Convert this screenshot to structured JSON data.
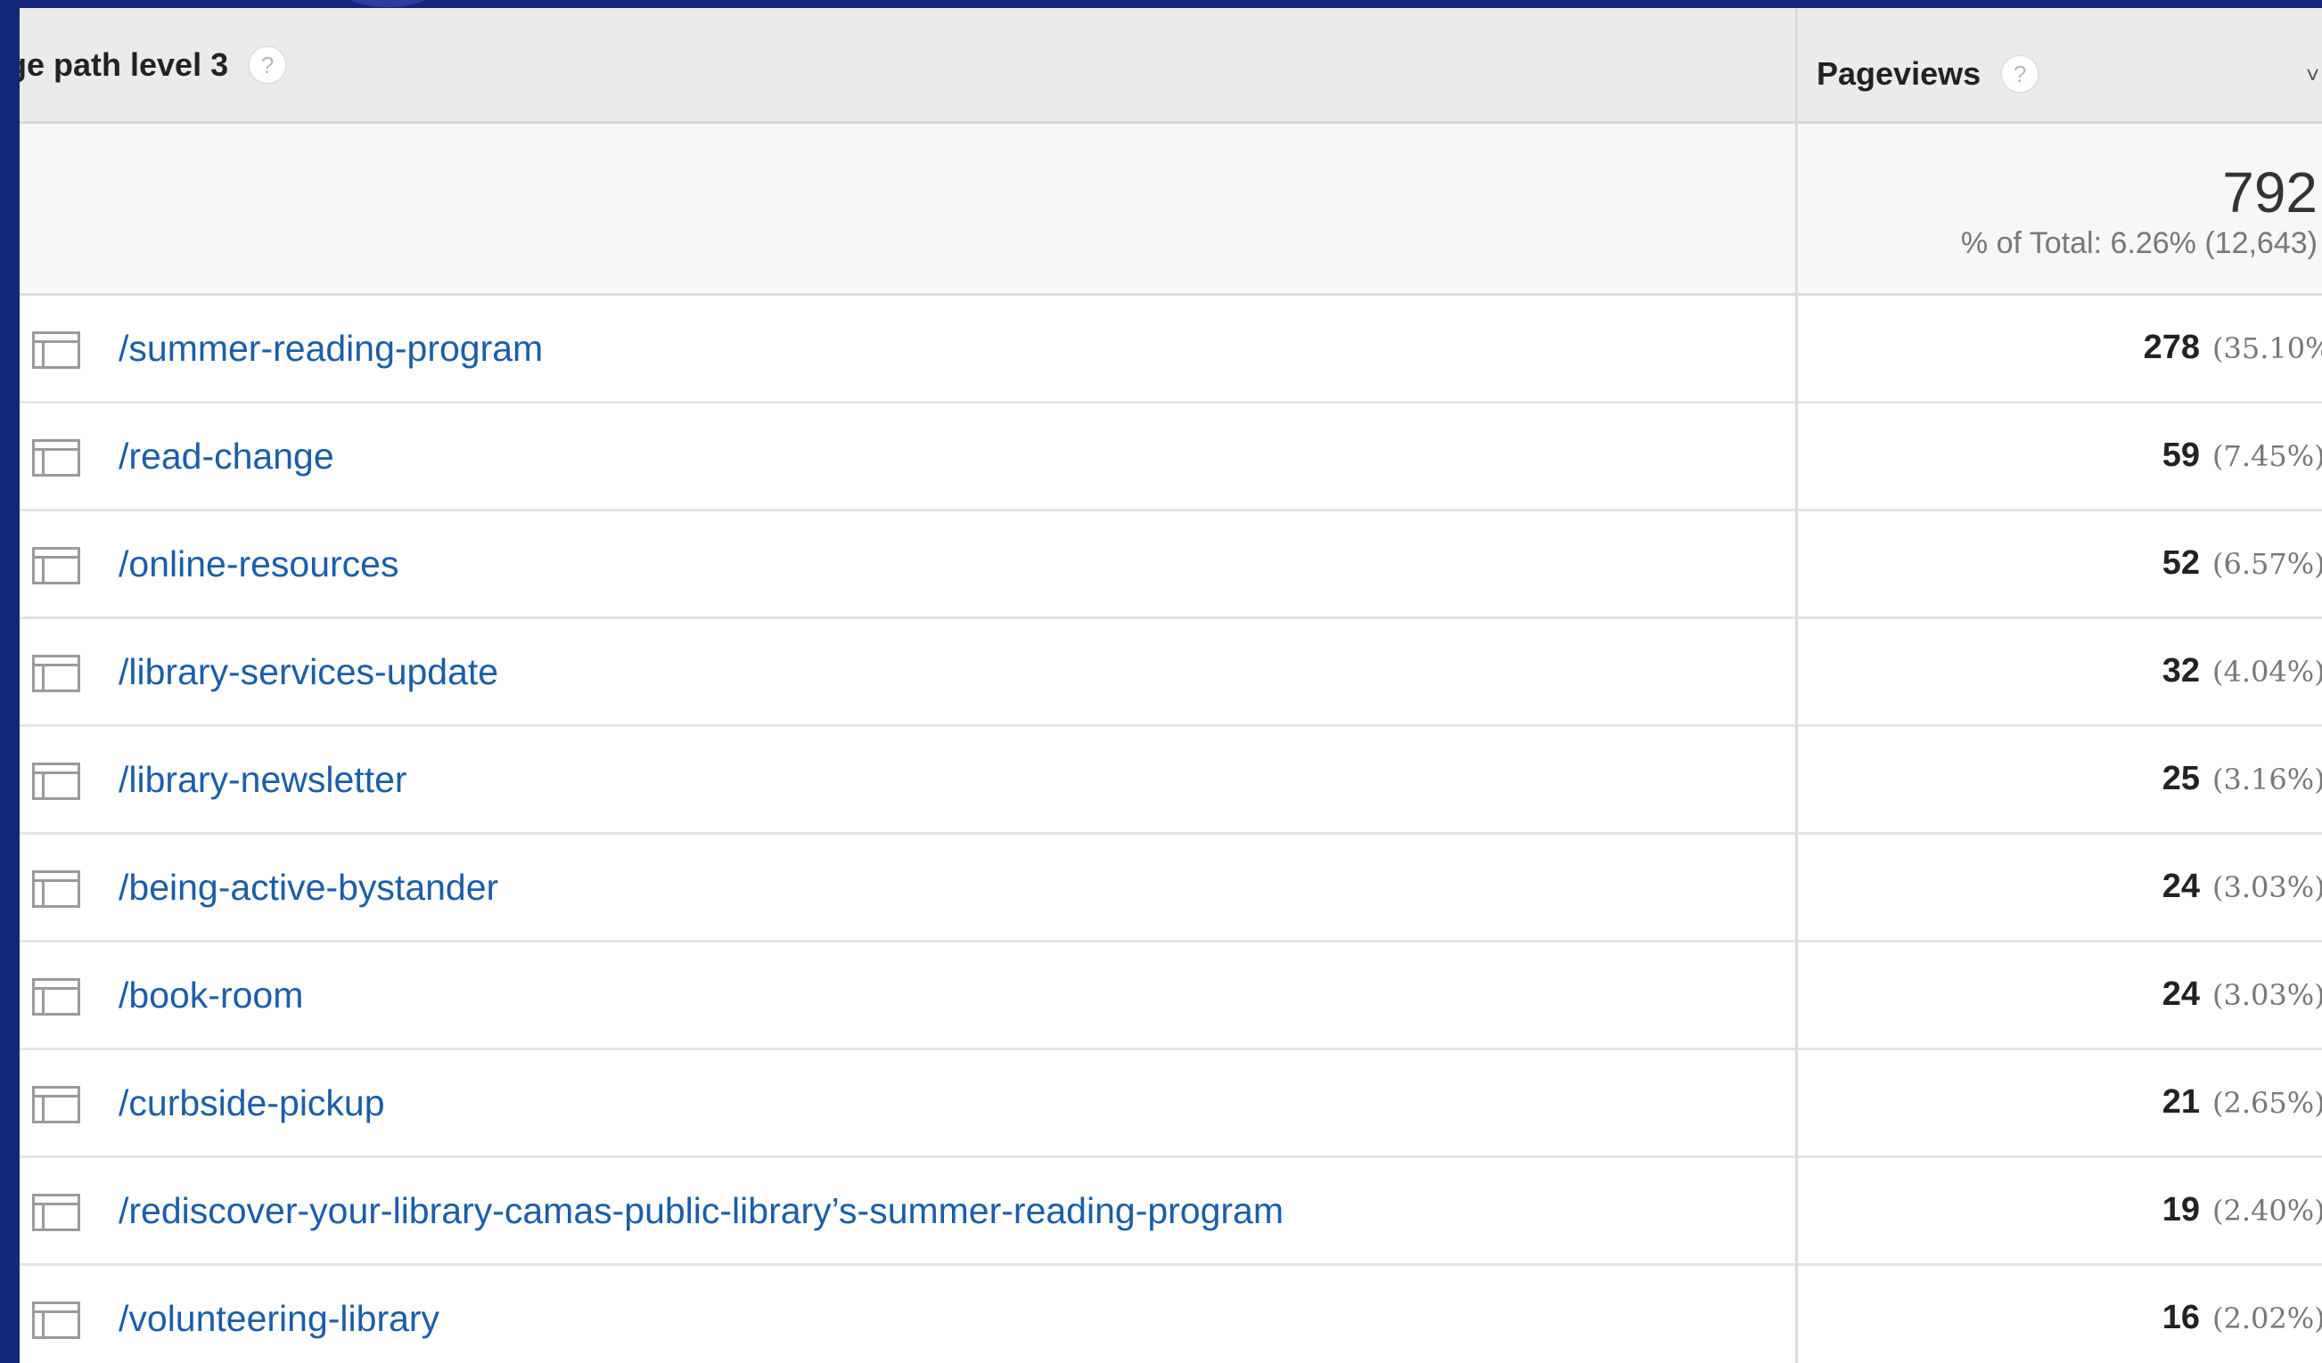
{
  "header": {
    "dimension_label": "ge path level 3",
    "metric_label": "Pageviews",
    "help_glyph": "?",
    "sort_glyph": "˅"
  },
  "summary": {
    "total": "792",
    "pct_of_total": "% of Total: 6.26% (12,643)"
  },
  "rows": [
    {
      "path": "/summer-reading-program",
      "pageviews": "278",
      "pct": "(35.10%)"
    },
    {
      "path": "/read-change",
      "pageviews": "59",
      "pct": "(7.45%)"
    },
    {
      "path": "/online-resources",
      "pageviews": "52",
      "pct": "(6.57%)"
    },
    {
      "path": "/library-services-update",
      "pageviews": "32",
      "pct": "(4.04%)"
    },
    {
      "path": "/library-newsletter",
      "pageviews": "25",
      "pct": "(3.16%)"
    },
    {
      "path": "/being-active-bystander",
      "pageviews": "24",
      "pct": "(3.03%)"
    },
    {
      "path": "/book-room",
      "pageviews": "24",
      "pct": "(3.03%)"
    },
    {
      "path": "/curbside-pickup",
      "pageviews": "21",
      "pct": "(2.65%)"
    },
    {
      "path": "/rediscover-your-library-camas-public-library’s-summer-reading-program",
      "pageviews": "19",
      "pct": "(2.40%)"
    },
    {
      "path": "/volunteering-library",
      "pageviews": "16",
      "pct": "(2.02%)"
    }
  ],
  "icons": {
    "row_icon": "page-window-icon",
    "help_icon": "help-circle-icon",
    "sort_icon": "sort-chevron-icon"
  },
  "colors": {
    "frame": "#13277a",
    "link": "#1a5ea8",
    "header_bg": "#ebebeb"
  }
}
